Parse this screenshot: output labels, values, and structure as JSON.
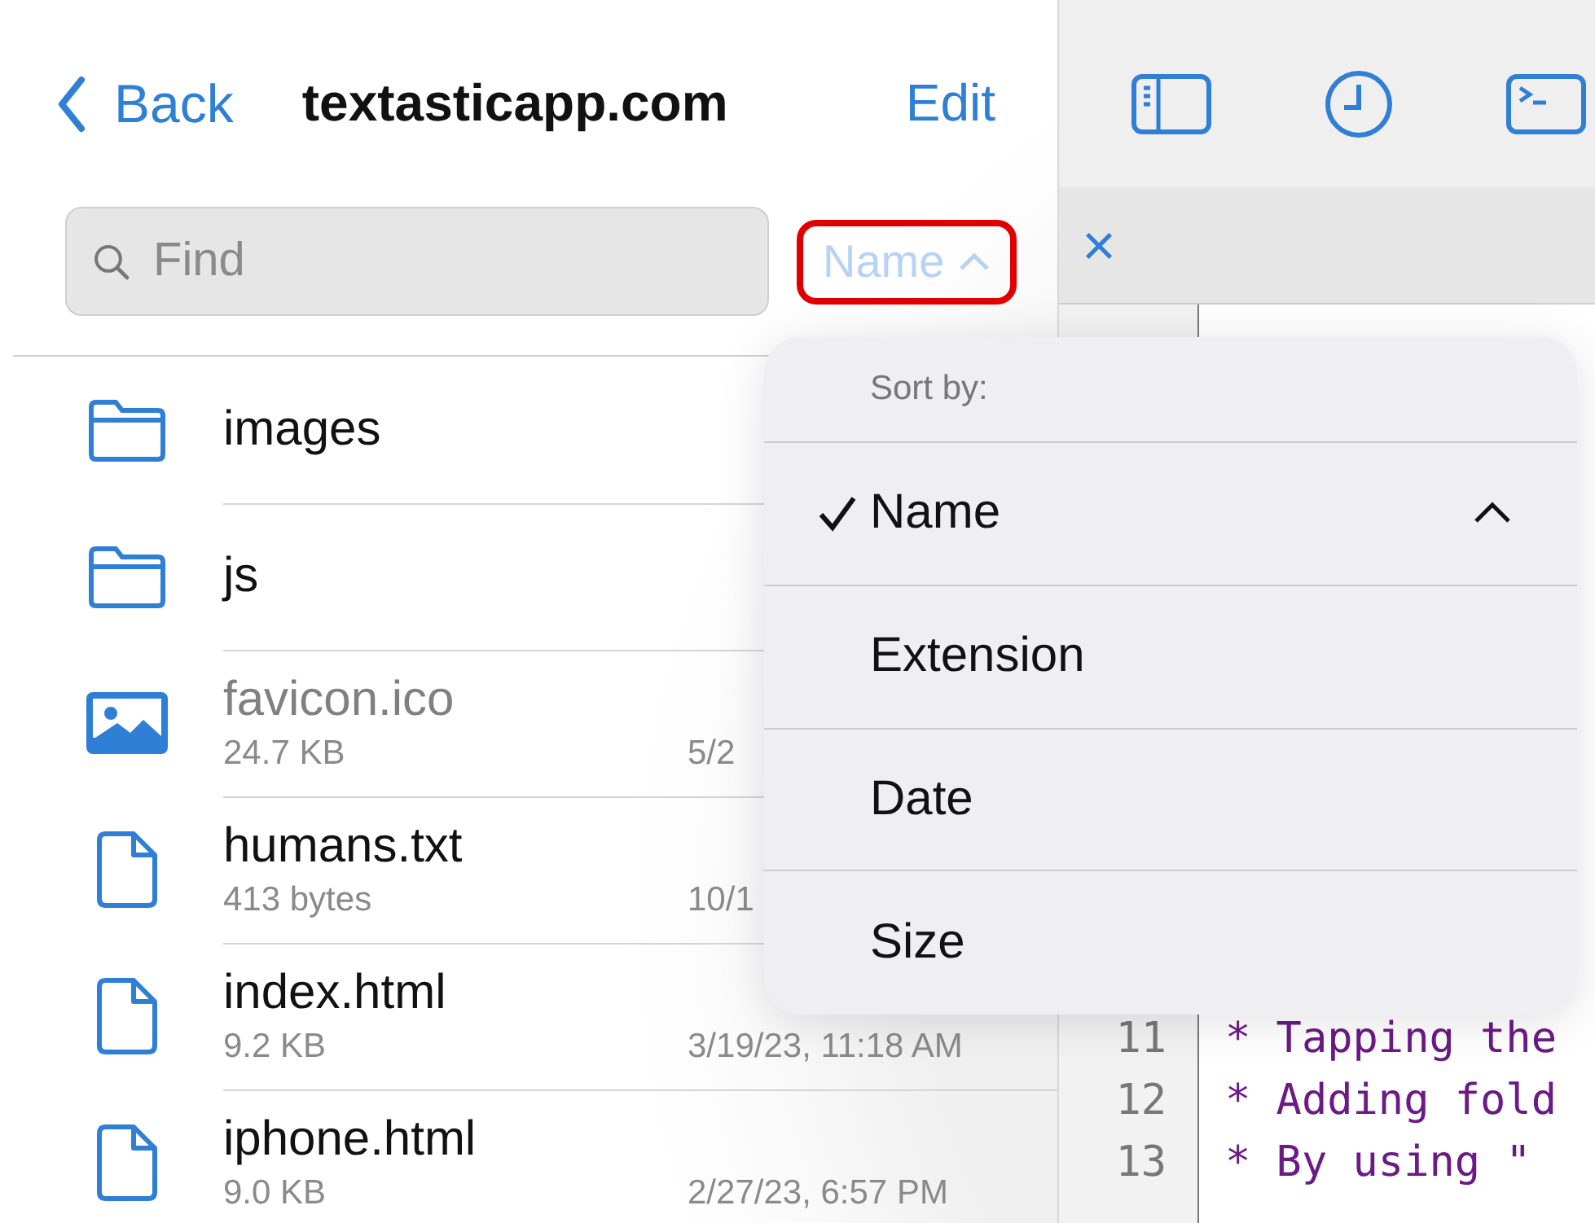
{
  "nav": {
    "back": "Back",
    "title": "textasticapp.com",
    "edit": "Edit"
  },
  "search": {
    "placeholder": "Find"
  },
  "sort_button": {
    "label": "Name",
    "highlighted": true
  },
  "files": [
    {
      "kind": "folder",
      "name": "images",
      "dimmed": false
    },
    {
      "kind": "folder",
      "name": "js",
      "dimmed": false
    },
    {
      "kind": "image",
      "name": "favicon.ico",
      "size": "24.7 KB",
      "date": "5/2",
      "dimmed": true
    },
    {
      "kind": "file",
      "name": "humans.txt",
      "size": "413 bytes",
      "date": "10/1",
      "dimmed": false
    },
    {
      "kind": "file",
      "name": "index.html",
      "size": "9.2 KB",
      "date": "3/19/23, 11:18 AM",
      "dimmed": false
    },
    {
      "kind": "file",
      "name": "iphone.html",
      "size": "9.0 KB",
      "date": "2/27/23, 6:57 PM",
      "dimmed": false
    }
  ],
  "tab_close": "×",
  "code_lines": [
    {
      "number": "11",
      "text": "* Tapping the"
    },
    {
      "number": "12",
      "text": "* Adding fold"
    },
    {
      "number": "13",
      "text": "* By using \""
    }
  ],
  "sort_menu": {
    "title": "Sort by:",
    "options": [
      {
        "label": "Name",
        "selected": true,
        "ascending": true
      },
      {
        "label": "Extension",
        "selected": false,
        "ascending": false
      },
      {
        "label": "Date",
        "selected": false,
        "ascending": false
      },
      {
        "label": "Size",
        "selected": false,
        "ascending": false
      }
    ]
  }
}
